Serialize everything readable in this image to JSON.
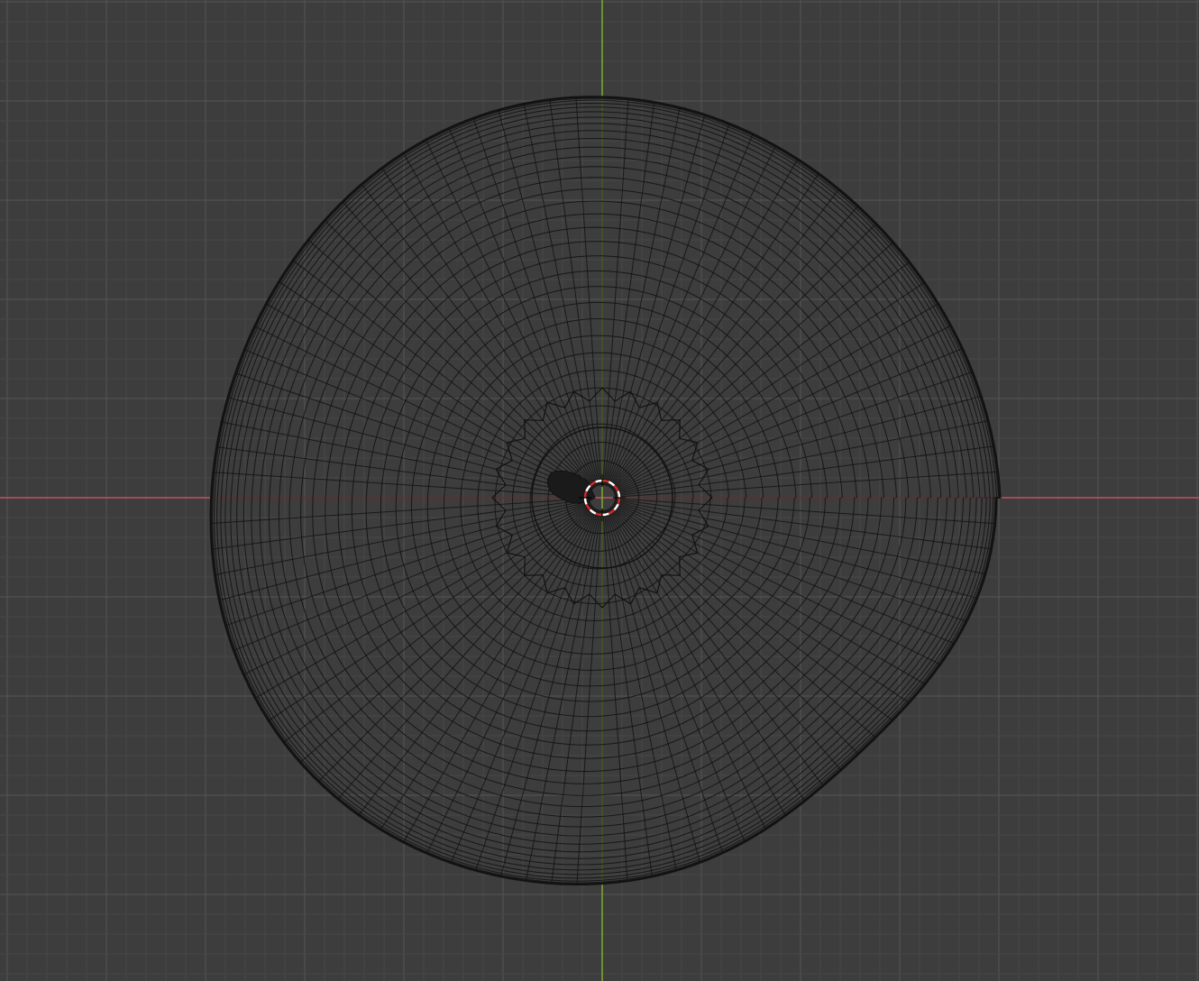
{
  "viewport": {
    "view": "top-orthographic",
    "shading": "wireframe",
    "background_color": "#3d3d3d",
    "grid_minor_color": "#474747",
    "grid_major_color": "#555555",
    "x_axis_color": "#c4515e",
    "y_axis_color": "#7fab2f",
    "wire_color": "#111111",
    "cursor_colors": [
      "#d22a2a",
      "#ffffff"
    ]
  },
  "objects": [
    {
      "name": "wireframe-mesh",
      "shape": "sphere-like",
      "icon": "wireframe-mesh"
    }
  ],
  "cursor": {
    "icon": "3d-cursor-icon"
  }
}
